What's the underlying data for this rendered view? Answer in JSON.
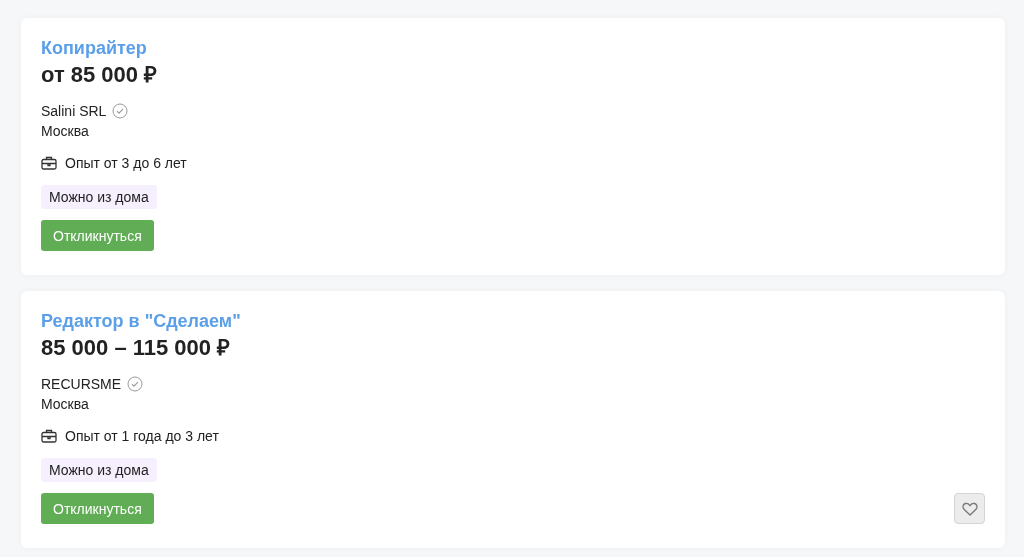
{
  "vacancies": [
    {
      "title": "Копирайтер",
      "salary": "от 85 000 ₽",
      "company": "Salini SRL",
      "verified": true,
      "city": "Москва",
      "experience": "Опыт от 3 до 6 лет",
      "tags": [
        "Можно из дома"
      ],
      "respond_button": "Откликнуться",
      "favorite_button": false
    },
    {
      "title": "Редактор в \"Сделаем\"",
      "salary": "85 000 – 115 000 ₽",
      "company": "RECURSME",
      "verified": true,
      "city": "Москва",
      "experience": "Опыт от 1 года до 3 лет",
      "tags": [
        "Можно из дома"
      ],
      "respond_button": "Откликнуться",
      "favorite_button": true
    }
  ]
}
